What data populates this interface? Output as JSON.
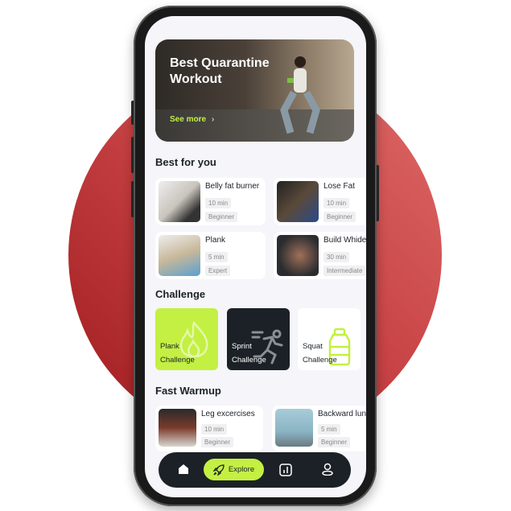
{
  "hero": {
    "title": "Best Quarantine Workout",
    "link": "See more",
    "link_icon": "chevron-right-icon"
  },
  "best_for_you": {
    "title": "Best for you",
    "items": [
      {
        "name": "Belly fat burner",
        "duration": "10 min",
        "level": "Beginner"
      },
      {
        "name": "Lose Fat",
        "duration": "10 min",
        "level": "Beginner"
      },
      {
        "name": "Plank",
        "duration": "5 min",
        "level": "Expert"
      },
      {
        "name": "Build Whide",
        "duration": "30 min",
        "level": "Intermediate"
      }
    ]
  },
  "challenge": {
    "title": "Challenge",
    "items": [
      {
        "line1": "Plank",
        "line2": "Challenge",
        "icon": "flame-icon",
        "color": "#c3f042"
      },
      {
        "line1": "Sprint",
        "line2": "Challenge",
        "icon": "runner-icon",
        "color": "#1c2127"
      },
      {
        "line1": "Squat",
        "line2": "Challenge",
        "icon": "bottle-icon",
        "color": "#ffffff"
      }
    ]
  },
  "fast_warmup": {
    "title": "Fast Warmup",
    "items": [
      {
        "name": "Leg excercises",
        "duration": "10 min",
        "level": "Beginner"
      },
      {
        "name": "Backward lunge",
        "duration": "5 min",
        "level": "Beginner"
      }
    ]
  },
  "nav": {
    "items": [
      {
        "icon": "home-icon"
      },
      {
        "label": "Explore",
        "icon": "rocket-icon",
        "active": true
      },
      {
        "icon": "chart-icon"
      },
      {
        "icon": "profile-icon"
      }
    ]
  },
  "colors": {
    "accent": "#c3f042",
    "dark": "#1c2127",
    "background": "#f5f5fa"
  }
}
